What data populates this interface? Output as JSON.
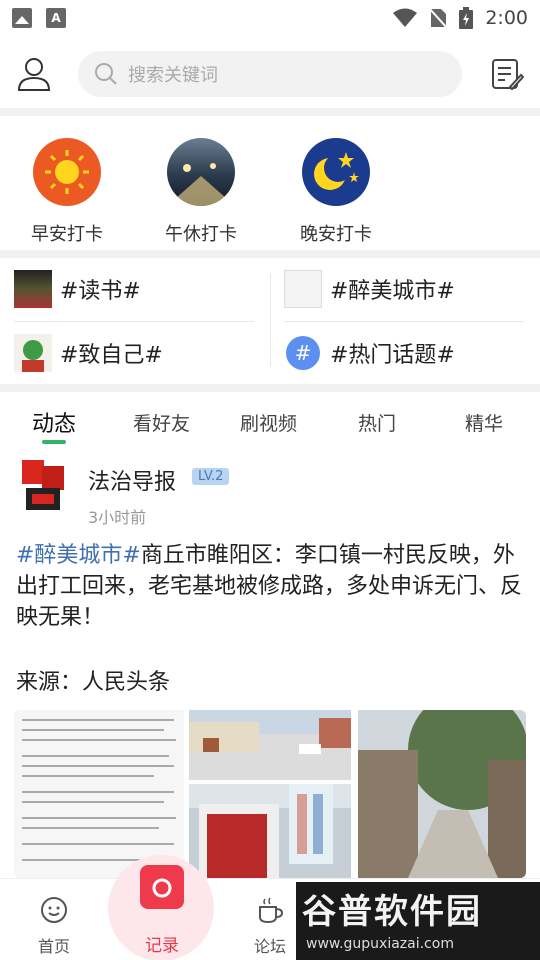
{
  "status_bar": {
    "time": "2:00"
  },
  "header": {
    "search_placeholder": "搜索关键词"
  },
  "checkin": [
    {
      "label": "早安打卡"
    },
    {
      "label": "午休打卡"
    },
    {
      "label": "晚安打卡"
    }
  ],
  "topics": [
    {
      "label": "#读书#"
    },
    {
      "label": "#醉美城市#"
    },
    {
      "label": "#致自己#"
    },
    {
      "label": "#热门话题#"
    }
  ],
  "tabs": [
    {
      "label": "动态"
    },
    {
      "label": "看好友"
    },
    {
      "label": "刷视频"
    },
    {
      "label": "热门"
    },
    {
      "label": "精华"
    }
  ],
  "post": {
    "author": "法治导报",
    "level": "LV.2",
    "time": "3小时前",
    "tag": "#醉美城市#",
    "text": "商丘市睢阳区：李口镇一村民反映，外出打工回来，老宅基地被修成路，多处申诉无门、反映无果！",
    "source": "来源：人民头条"
  },
  "bottom_nav": {
    "home": "首页",
    "record": "记录",
    "forum": "论坛"
  },
  "watermark": {
    "title": "谷普软件园",
    "url": "www.gupuxiazai.com"
  }
}
